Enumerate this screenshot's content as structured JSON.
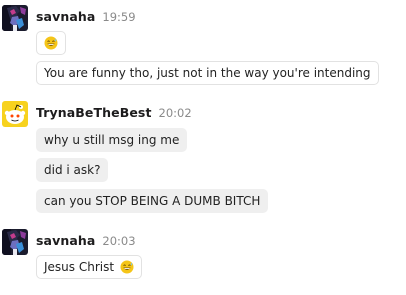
{
  "colors": {
    "username": "#1d1c1d",
    "timestamp": "#8a8a8a",
    "bubble_fill": "#efefef",
    "bubble_border": "#e2e2e2",
    "emoji_yellow": "#f5c518"
  },
  "messages": [
    {
      "author": "savnaha",
      "time": "19:59",
      "avatar_icon": "anime-avatar-icon",
      "lines": [
        {
          "text": "",
          "emoji": "grinning-sweat-emoji-icon",
          "style": "outlined"
        },
        {
          "text": "You are funny tho, just not in the way you're intending",
          "style": "outlined"
        }
      ]
    },
    {
      "author": "TrynaBeTheBest",
      "time": "20:02",
      "avatar_icon": "snoo-avatar-icon",
      "lines": [
        {
          "text": "why u still msg ing me",
          "style": "filled"
        },
        {
          "text": "did i ask?",
          "style": "filled"
        },
        {
          "text": "can you STOP BEING A DUMB BITCH",
          "style": "filled"
        }
      ]
    },
    {
      "author": "savnaha",
      "time": "20:03",
      "avatar_icon": "anime-avatar-icon",
      "lines": [
        {
          "text": "Jesus Christ",
          "emoji": "grinning-sweat-emoji-icon",
          "style": "outlined"
        }
      ]
    }
  ]
}
